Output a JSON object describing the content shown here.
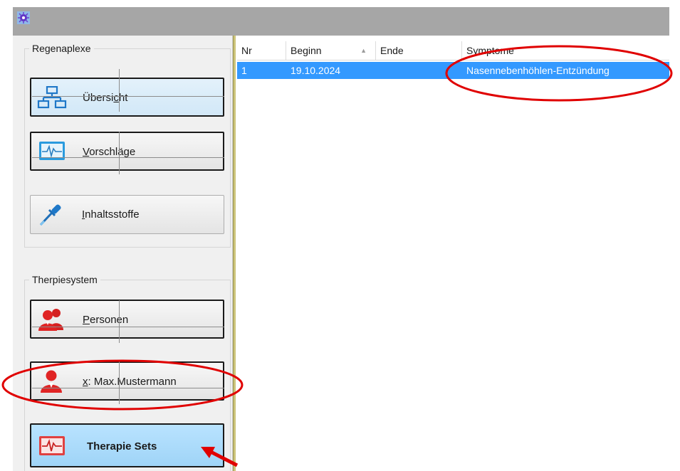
{
  "left_panel": {
    "regen_group": {
      "title": "Regenaplexe",
      "buttons": [
        {
          "pre": "Übersi",
          "u": "c",
          "post": "ht"
        },
        {
          "pre": "",
          "u": "V",
          "post": "orschläge"
        },
        {
          "pre": "",
          "u": "I",
          "post": "nhaltsstoffe"
        }
      ]
    },
    "therapy_group": {
      "title": "Therpiesystem",
      "buttons": [
        {
          "pre": "",
          "u": "P",
          "post": "ersonen"
        },
        {
          "pre": "",
          "u": "x",
          "post": ": Max.Mustermann"
        },
        {
          "pre": "",
          "u": "",
          "post": "Therapie Sets"
        }
      ]
    }
  },
  "table": {
    "columns": [
      "Nr",
      "Beginn",
      "Ende",
      "Symptome"
    ],
    "rows": [
      {
        "nr": "1",
        "beginn": "19.10.2024",
        "ende": "",
        "symptome": "Nasennebenhöhlen-Entzündung"
      }
    ]
  },
  "colors": {
    "titlebar": "#a6a6a6",
    "selection": "#3399ff",
    "active_button": "#9fd4f7",
    "annotation": "#e00000"
  }
}
